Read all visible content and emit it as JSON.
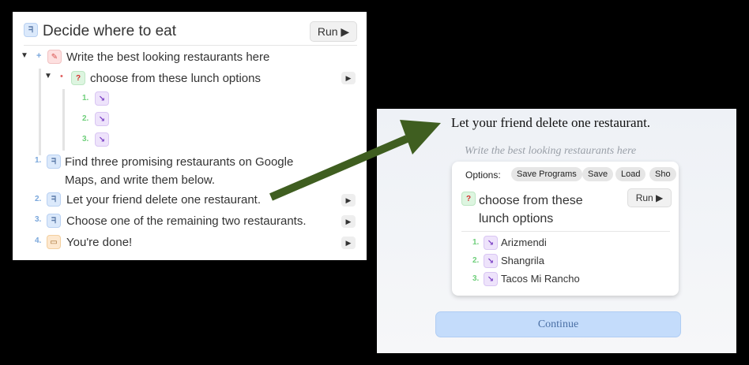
{
  "left": {
    "title": "Decide where to eat",
    "run_label": "Run ▶",
    "steps": [
      {
        "text": "Write the best looking restaurants here"
      },
      {
        "text": "choose from these lunch options"
      }
    ],
    "options_nums": [
      "1.",
      "2.",
      "3."
    ],
    "numbered": [
      {
        "num": "1.",
        "line1": "Find three promising restaurants on Google",
        "line2": "Maps, and write them below."
      },
      {
        "num": "2.",
        "line1": "Let your friend delete one restaurant."
      },
      {
        "num": "3.",
        "line1": "Choose one of the remaining two restaurants."
      },
      {
        "num": "4.",
        "line1": "You're done!"
      }
    ],
    "play_glyph": "▶"
  },
  "right": {
    "heading": "Let your friend delete one restaurant.",
    "subheading": "Write the best looking restaurants here",
    "options_label": "Options:",
    "option_buttons": [
      "Save Programs",
      "Save",
      "Load",
      "Sho"
    ],
    "card_title": "choose from these lunch options",
    "card_run": "Run ▶",
    "items": [
      {
        "num": "1.",
        "label": "Arizmendi"
      },
      {
        "num": "2.",
        "label": "Shangrila"
      },
      {
        "num": "3.",
        "label": "Tacos Mi Rancho"
      }
    ],
    "continue_label": "Continue"
  },
  "icons": {
    "person": "person-icon",
    "pencil": "pencil-icon",
    "question": "question-icon",
    "arrow": "arrow-down-right-icon",
    "book": "book-icon"
  },
  "colors": {
    "arrow": "#3f5e20",
    "continue_bg": "#c4dcfb",
    "number_blue": "#7aa7dc",
    "number_green": "#6fcf7b"
  }
}
